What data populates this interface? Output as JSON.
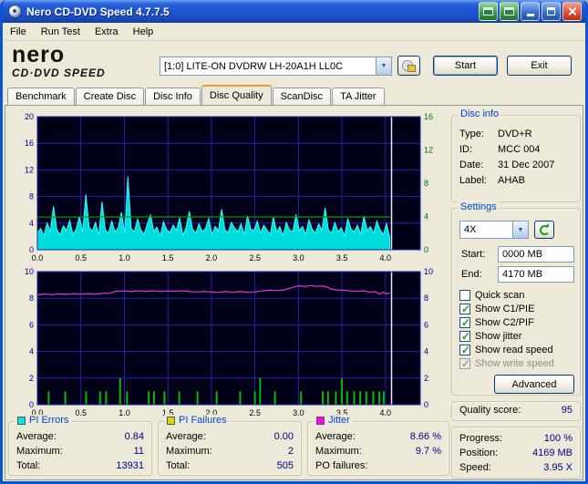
{
  "window": {
    "title": "Nero CD-DVD Speed 4.7.7.5"
  },
  "menu": {
    "items": [
      "File",
      "Run Test",
      "Extra",
      "Help"
    ]
  },
  "header": {
    "logo_line1": "nero",
    "logo_line2": "CD·DVD SPEED",
    "drive_combo": "[1:0]  LITE-ON DVDRW LH-20A1H LL0C",
    "start_button": "Start",
    "exit_button": "Exit"
  },
  "tabs": {
    "items": [
      "Benchmark",
      "Create Disc",
      "Disc Info",
      "Disc Quality",
      "ScanDisc",
      "TA Jitter"
    ],
    "active": "Disc Quality"
  },
  "disc_info": {
    "title": "Disc info",
    "rows": [
      {
        "label": "Type:",
        "value": "DVD+R"
      },
      {
        "label": "ID:",
        "value": "MCC 004"
      },
      {
        "label": "Date:",
        "value": "31 Dec 2007"
      },
      {
        "label": "Label:",
        "value": "AHAB"
      }
    ]
  },
  "settings": {
    "title": "Settings",
    "speed_value": "4X",
    "start_label": "Start:",
    "start_value": "0000 MB",
    "end_label": "End:",
    "end_value": "4170 MB",
    "checkboxes": [
      {
        "label": "Quick scan",
        "checked": false,
        "disabled": false
      },
      {
        "label": "Show C1/PIE",
        "checked": true,
        "disabled": false
      },
      {
        "label": "Show C2/PIF",
        "checked": true,
        "disabled": false
      },
      {
        "label": "Show jitter",
        "checked": true,
        "disabled": false
      },
      {
        "label": "Show read speed",
        "checked": true,
        "disabled": false
      },
      {
        "label": "Show write speed",
        "checked": true,
        "disabled": true
      }
    ],
    "advanced_button": "Advanced"
  },
  "quality": {
    "label": "Quality score:",
    "value": "95"
  },
  "progress": {
    "rows": [
      {
        "label": "Progress:",
        "value": "100 %"
      },
      {
        "label": "Position:",
        "value": "4169 MB"
      },
      {
        "label": "Speed:",
        "value": "3.95 X"
      }
    ]
  },
  "stats": {
    "pi_errors": {
      "title": "PI Errors",
      "color": "#00E5E5",
      "rows": [
        [
          "Average:",
          "0.84"
        ],
        [
          "Maximum:",
          "11"
        ],
        [
          "Total:",
          "13931"
        ]
      ]
    },
    "pi_failures": {
      "title": "PI Failures",
      "color": "#D8D800",
      "rows": [
        [
          "Average:",
          "0.00"
        ],
        [
          "Maximum:",
          "2"
        ],
        [
          "Total:",
          "505"
        ]
      ]
    },
    "jitter": {
      "title": "Jitter",
      "color": "#FF00FF",
      "rows": [
        [
          "Average:",
          "8.66 %"
        ],
        [
          "Maximum:",
          "9.7 %"
        ],
        [
          "PO failures:",
          ""
        ]
      ]
    }
  },
  "icons": {
    "dropdown_arrow": "▼"
  },
  "chart_data": [
    {
      "type": "area",
      "name": "pi-errors-and-read-speed",
      "bg": "#000018",
      "grid": "#2323AE",
      "x_label_color": "#000000",
      "marker_color": "#E8E8FF",
      "x_min": 0,
      "x_max": 4.4,
      "x_tick_step": 0.5,
      "x_tick_max": 4.0,
      "axes": {
        "left": {
          "min": 0,
          "max": 20,
          "step": 4,
          "color": "#0000A0"
        },
        "right": {
          "min": 0,
          "max": 16,
          "step": 4,
          "color": "#007800"
        }
      },
      "marker_x": 4.07,
      "series": [
        {
          "name": "PI Errors",
          "type": "area",
          "axis": "left",
          "color": "#30FFFF",
          "fill": "#00DCDC",
          "x_start": 0,
          "x_end": 4.05,
          "values": [
            2.5,
            3.2,
            2.1,
            4.0,
            2.8,
            6.5,
            3.1,
            2.2,
            3.6,
            2.9,
            4.4,
            2.3,
            3.1,
            5.0,
            2.6,
            8.3,
            3.4,
            2.8,
            4.1,
            2.2,
            7.2,
            3.0,
            2.5,
            4.3,
            2.7,
            3.3,
            5.6,
            2.4,
            11.0,
            3.2,
            2.7,
            4.6,
            3.0,
            2.3,
            3.9,
            5.2,
            2.8,
            3.4,
            2.1,
            4.2,
            3.0,
            2.6,
            3.7,
            2.9,
            4.8,
            2.2,
            3.3,
            5.8,
            3.1,
            2.5,
            3.9,
            2.7,
            3.2,
            4.7,
            2.3,
            3.5,
            2.9,
            6.1,
            3.0,
            2.6,
            4.1,
            3.3,
            2.7,
            3.9,
            2.2,
            5.1,
            3.1,
            2.9,
            4.3,
            2.5,
            3.7,
            3.0,
            2.3,
            4.9,
            2.7,
            3.5,
            2.1,
            4.1,
            3.0,
            2.7,
            5.3,
            2.9,
            3.5,
            2.3,
            4.5,
            3.1,
            2.5,
            3.9,
            2.9,
            6.3,
            3.0,
            2.5,
            4.1,
            2.7,
            3.3,
            2.1,
            4.7,
            3.1,
            2.7,
            3.7,
            2.3,
            5.1,
            2.9,
            3.5,
            2.5,
            4.3,
            3.0,
            2.3,
            3.9,
            1.8
          ]
        },
        {
          "name": "Read speed",
          "type": "line",
          "axis": "right",
          "color": "#00A000",
          "points": [
            [
              0,
              3.92
            ],
            [
              1.0,
              3.95
            ],
            [
              2.0,
              3.96
            ],
            [
              3.0,
              3.95
            ],
            [
              4.05,
              3.95
            ]
          ]
        }
      ]
    },
    {
      "type": "line",
      "name": "jitter-and-pi-failures",
      "bg": "#000018",
      "grid": "#2323AE",
      "x_label_color": "#000000",
      "marker_color": "#E8E8FF",
      "x_min": 0,
      "x_max": 4.4,
      "x_tick_step": 0.5,
      "x_tick_max": 4.0,
      "axes": {
        "left": {
          "min": 0,
          "max": 10,
          "step": 2,
          "color": "#0000A0"
        },
        "right": {
          "min": 0,
          "max": 10,
          "step": 2,
          "color": "#0000A0"
        }
      },
      "marker_x": 4.07,
      "series": [
        {
          "name": "PI Failures",
          "type": "bars",
          "axis": "left",
          "color": "#00BE00",
          "points": [
            [
              0.13,
              1
            ],
            [
              0.32,
              1
            ],
            [
              0.56,
              1
            ],
            [
              0.72,
              1
            ],
            [
              0.79,
              1
            ],
            [
              0.95,
              2
            ],
            [
              1.03,
              1
            ],
            [
              1.28,
              1
            ],
            [
              1.34,
              1
            ],
            [
              1.46,
              1
            ],
            [
              1.63,
              1
            ],
            [
              1.84,
              1
            ],
            [
              2.06,
              1
            ],
            [
              2.33,
              1
            ],
            [
              2.5,
              1
            ],
            [
              2.56,
              2
            ],
            [
              2.73,
              1
            ],
            [
              3.03,
              1
            ],
            [
              3.28,
              1
            ],
            [
              3.34,
              1
            ],
            [
              3.43,
              1
            ],
            [
              3.5,
              2
            ],
            [
              3.56,
              1
            ],
            [
              3.64,
              1
            ],
            [
              3.71,
              1
            ],
            [
              3.78,
              1
            ],
            [
              3.86,
              1
            ],
            [
              3.93,
              1
            ],
            [
              3.98,
              1
            ]
          ]
        },
        {
          "name": "Jitter",
          "type": "line",
          "axis": "left",
          "color": "#E632E6",
          "points": [
            [
              0,
              8.25
            ],
            [
              0.08,
              8.32
            ],
            [
              0.16,
              8.27
            ],
            [
              0.25,
              8.33
            ],
            [
              0.33,
              8.29
            ],
            [
              0.42,
              8.34
            ],
            [
              0.5,
              8.3
            ],
            [
              0.58,
              8.35
            ],
            [
              0.66,
              8.31
            ],
            [
              0.75,
              8.36
            ],
            [
              0.83,
              8.38
            ],
            [
              0.9,
              8.52
            ],
            [
              1.0,
              8.55
            ],
            [
              1.08,
              8.5
            ],
            [
              1.16,
              8.56
            ],
            [
              1.25,
              8.52
            ],
            [
              1.33,
              8.56
            ],
            [
              1.41,
              8.51
            ],
            [
              1.5,
              8.55
            ],
            [
              1.58,
              8.52
            ],
            [
              1.66,
              8.56
            ],
            [
              1.75,
              8.5
            ],
            [
              1.83,
              8.47
            ],
            [
              1.91,
              8.51
            ],
            [
              2.0,
              8.48
            ],
            [
              2.08,
              8.44
            ],
            [
              2.16,
              8.5
            ],
            [
              2.25,
              8.46
            ],
            [
              2.33,
              8.5
            ],
            [
              2.41,
              8.45
            ],
            [
              2.5,
              8.48
            ],
            [
              2.58,
              8.55
            ],
            [
              2.66,
              8.6
            ],
            [
              2.75,
              8.58
            ],
            [
              2.83,
              8.62
            ],
            [
              2.9,
              8.75
            ],
            [
              2.96,
              8.88
            ],
            [
              3.02,
              8.93
            ],
            [
              3.08,
              8.88
            ],
            [
              3.14,
              8.95
            ],
            [
              3.2,
              8.9
            ],
            [
              3.26,
              8.92
            ],
            [
              3.32,
              8.86
            ],
            [
              3.38,
              8.68
            ],
            [
              3.45,
              8.62
            ],
            [
              3.52,
              8.6
            ],
            [
              3.6,
              8.55
            ],
            [
              3.68,
              8.52
            ],
            [
              3.75,
              8.56
            ],
            [
              3.82,
              8.45
            ],
            [
              3.88,
              8.5
            ],
            [
              3.93,
              8.3
            ],
            [
              3.97,
              8.45
            ],
            [
              4.01,
              8.33
            ],
            [
              4.05,
              8.38
            ]
          ]
        }
      ]
    }
  ]
}
